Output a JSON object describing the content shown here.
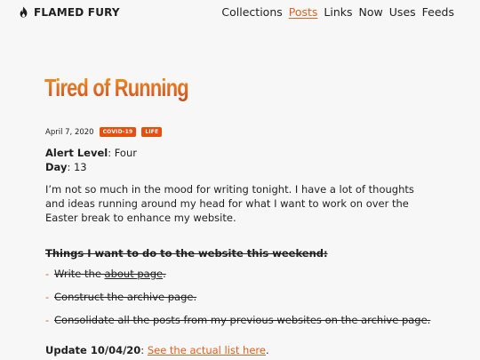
{
  "site": {
    "brand": "FLAMED FURY",
    "brand_icon": "flame-icon"
  },
  "nav": {
    "items": [
      "Collections",
      "Posts",
      "Links",
      "Now",
      "Uses",
      "Feeds"
    ],
    "active": "Posts"
  },
  "post": {
    "title": "Tired of Running",
    "date": "April 7, 2020",
    "tags": [
      "COVID-19",
      "LIFE"
    ],
    "alert_level_label": "Alert Level",
    "alert_level_value": ": Four",
    "day_label": "Day",
    "day_value": ": 13",
    "paragraph": "I’m not so much in the mood for writing tonight. I have a lot of thoughts and ideas running around my head for what I want to work on over the Easter break to enhance my website.",
    "todo_heading": "Things I want to do to the website this weekend:",
    "todos": [
      {
        "before": "Write the ",
        "link": "about page",
        "after": "."
      },
      {
        "before": "Construct the archive page.",
        "link": "",
        "after": ""
      },
      {
        "before": "Consolidate all the posts from my previous websites on the archive page.",
        "link": "",
        "after": ""
      }
    ],
    "update_label": "Update 10/04/20",
    "update_sep": ": ",
    "update_link": "See the actual list here",
    "update_end": "."
  },
  "colors": {
    "accent": "#e0621e",
    "badge": "#e94d10",
    "background": "#f7f7f7",
    "text": "#1f1f1f"
  }
}
